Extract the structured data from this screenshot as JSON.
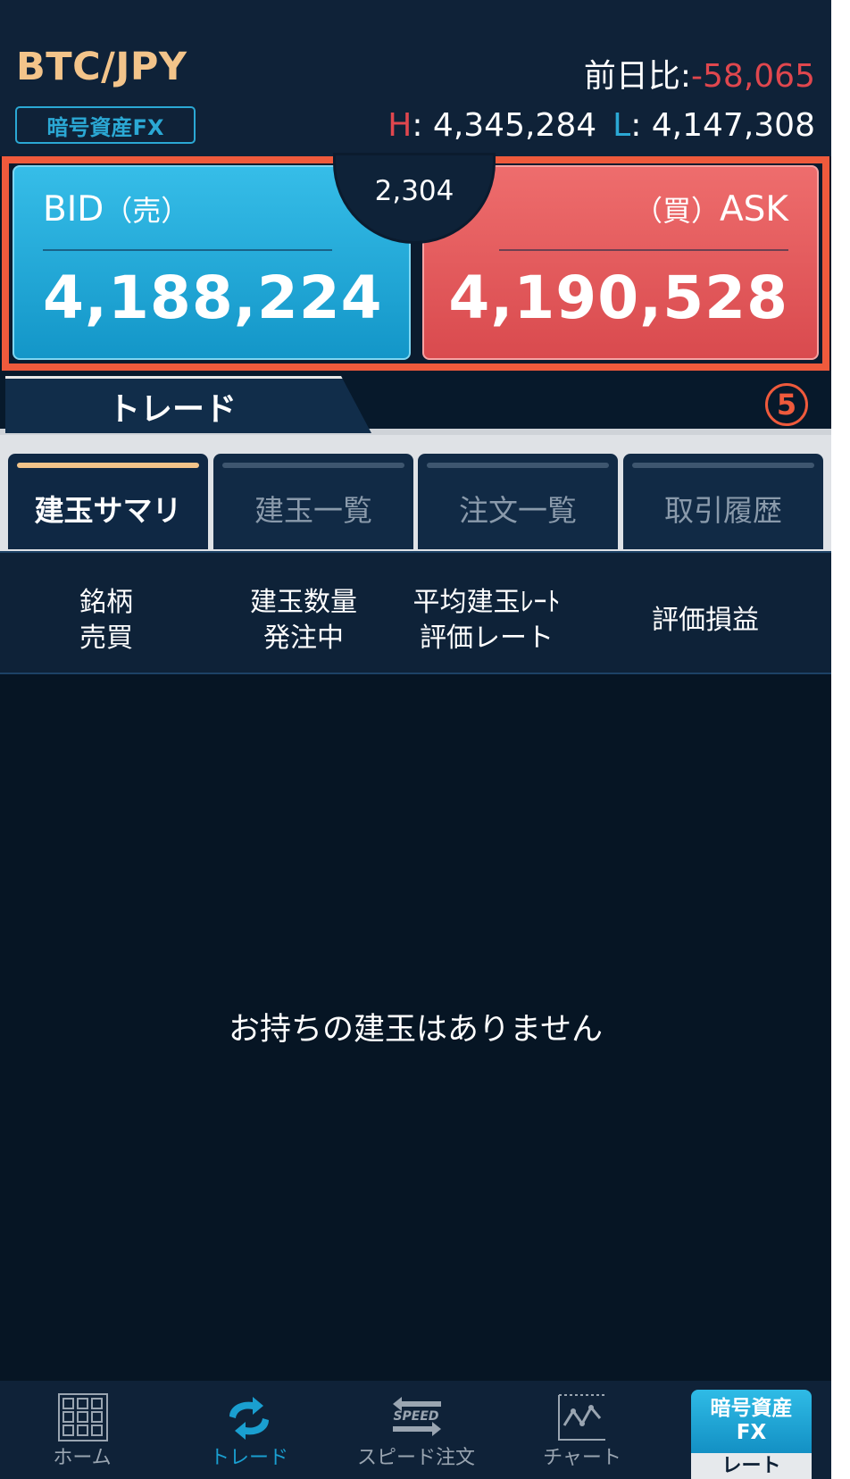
{
  "header": {
    "symbol": "BTC/JPY",
    "badge": "暗号資産FX",
    "change_label": "前日比:",
    "change_value": "-58,065",
    "high_label": "H",
    "high_value": ": 4,345,284",
    "low_label": "L",
    "low_value": ": 4,147,308"
  },
  "board": {
    "bid_label": "BID",
    "bid_paren": "（売）",
    "bid_price": "4,188,224",
    "ask_label": "ASK",
    "ask_paren": "（買）",
    "ask_price": "4,190,528",
    "spread": "2,304"
  },
  "trade_tab": {
    "label": "トレード",
    "step_number": "5"
  },
  "subtabs": [
    {
      "label": "建玉サマリ",
      "active": true
    },
    {
      "label": "建玉一覧",
      "active": false
    },
    {
      "label": "注文一覧",
      "active": false
    },
    {
      "label": "取引履歴",
      "active": false
    }
  ],
  "columns": {
    "col1_line1": "銘柄",
    "col1_line2": "売買",
    "col2_line1": "建玉数量",
    "col2_line2": "発注中",
    "col3_line1": "平均建玉ﾚｰﾄ",
    "col3_line2": "評価レート",
    "col4": "評価損益"
  },
  "empty_message": "お持ちの建玉はありません",
  "nav": {
    "home": "ホーム",
    "trade": "トレード",
    "speed": "スピード注文",
    "speed_icon_text": "SPEED",
    "chart": "チャート",
    "crypto_line1": "暗号資産",
    "crypto_line2": "FX",
    "crypto_line3": "レート"
  },
  "colors": {
    "accent_blue": "#1a9fd0",
    "bid_blue": "#36bde8",
    "ask_red": "#ee6d6d",
    "negative_red": "#e0474e",
    "gold": "#f3c48a",
    "highlight_orange": "#ef5a3c"
  }
}
